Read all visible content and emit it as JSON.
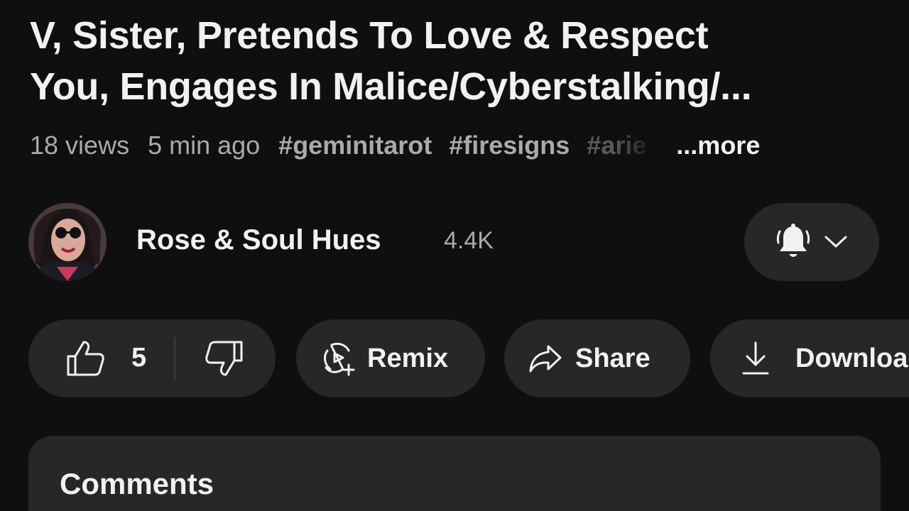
{
  "video": {
    "title_line1": "V, Sister, Pretends To Love & Respect",
    "title_line2": "You, Engages In Malice/Cyberstalking/...",
    "views": "18 views",
    "age": "5 min ago",
    "hashtags": [
      "#geminitarot",
      "#firesigns",
      "#arie"
    ],
    "more_label": "...more"
  },
  "channel": {
    "name": "Rose & Soul Hues",
    "subscribers": "4.4K",
    "avatar_icon": "channel-avatar",
    "bell_icon": "bell-icon",
    "dropdown_icon": "chevron-down-icon"
  },
  "actions": {
    "like_count": "5",
    "like_icon": "thumbs-up-icon",
    "dislike_icon": "thumbs-down-icon",
    "remix_label": "Remix",
    "remix_icon": "remix-icon",
    "share_label": "Share",
    "share_icon": "share-icon",
    "download_label": "Download",
    "download_icon": "download-icon"
  },
  "comments": {
    "title": "Comments"
  },
  "colors": {
    "background": "#0f0f0f",
    "surface": "#272727",
    "text_primary": "#f1f1f1",
    "text_secondary": "#aaaaaa"
  }
}
